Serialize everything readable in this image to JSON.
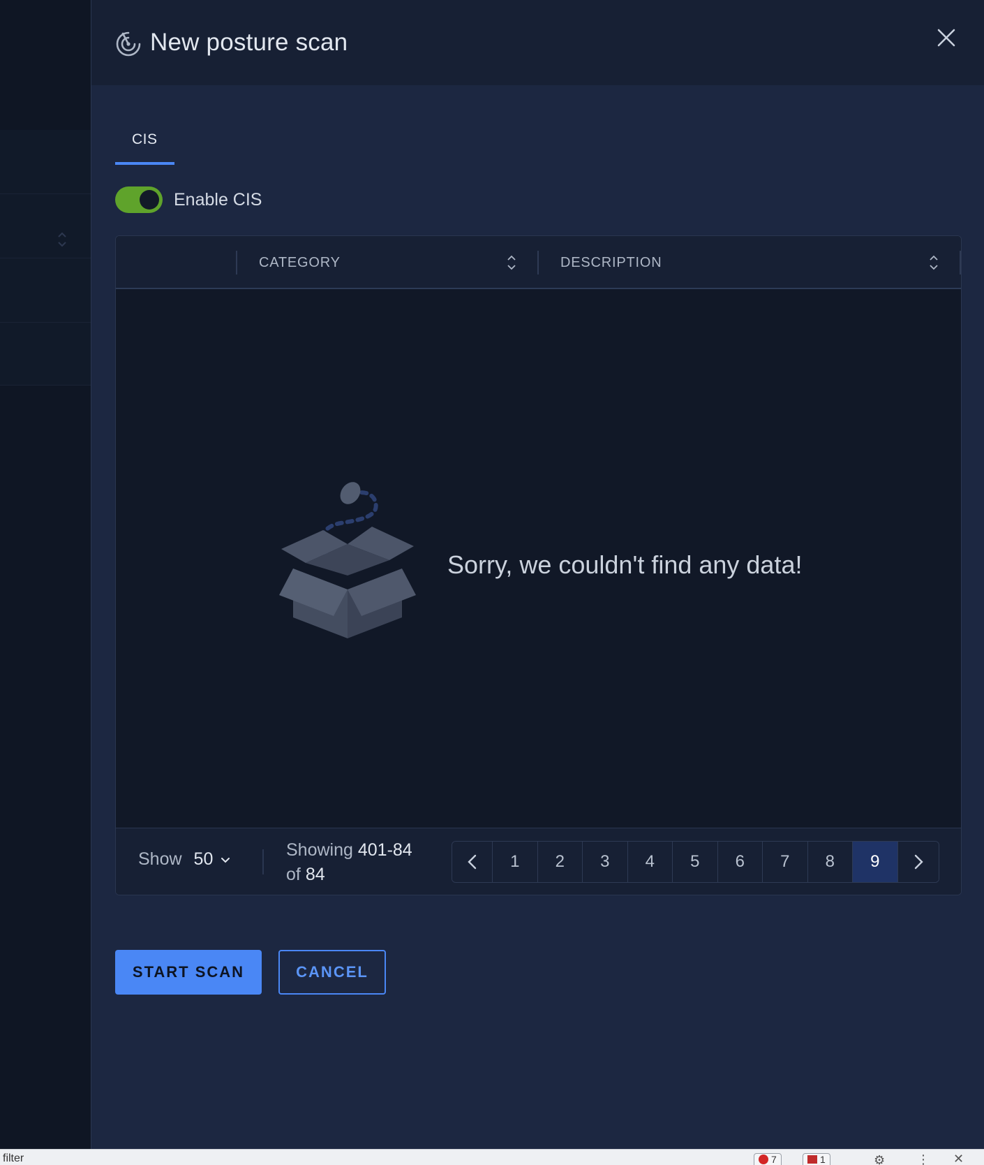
{
  "drawer": {
    "title": "New posture scan",
    "close_label": "×"
  },
  "tabs": [
    {
      "label": "CIS",
      "active": true
    }
  ],
  "toggle": {
    "label": "Enable CIS",
    "on": true,
    "color": "#5fa32b"
  },
  "table": {
    "columns": [
      {
        "label": "CATEGORY"
      },
      {
        "label": "DESCRIPTION"
      }
    ],
    "empty_message": "Sorry, we couldn't find any data!"
  },
  "footer": {
    "show_label": "Show",
    "page_size": "50",
    "showing_prefix": "Showing",
    "showing_range": "401-84",
    "showing_of": "of",
    "showing_total": "84",
    "pages": [
      "1",
      "2",
      "3",
      "4",
      "5",
      "6",
      "7",
      "8",
      "9"
    ],
    "current_page": "9"
  },
  "actions": {
    "primary": "START SCAN",
    "secondary": "CANCEL"
  },
  "statusbar": {
    "text": "filter",
    "error_count": "7",
    "warning_count": "1"
  },
  "colors": {
    "accent": "#4a87f5",
    "background": "#1c2741",
    "toggle_on": "#5fa32b"
  }
}
